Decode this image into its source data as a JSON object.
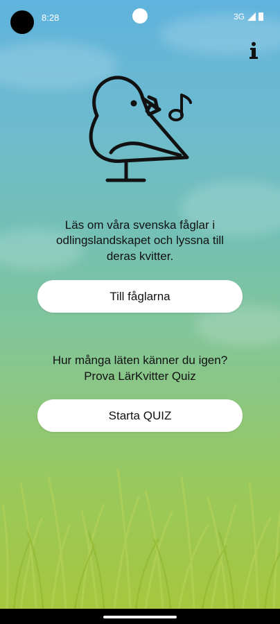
{
  "status_bar": {
    "time": "8:28",
    "network": "3G"
  },
  "main": {
    "intro_lines": [
      "Läs om våra svenska fåglar i",
      "odlingslandskapet och lyssna till",
      "deras kvitter."
    ],
    "birds_button_label": "Till fåglarna",
    "quiz_lines": [
      "Hur många läten känner du igen?",
      "Prova LärKvitter Quiz"
    ],
    "quiz_button_label": "Starta QUIZ"
  },
  "colors": {
    "sky_top": "#5fb3dd",
    "grass_bottom": "#a7c63a",
    "icon_dark": "#111111",
    "button_bg": "#ffffff"
  },
  "icons": {
    "info": "info-icon",
    "logo": "bird-music-logo"
  }
}
